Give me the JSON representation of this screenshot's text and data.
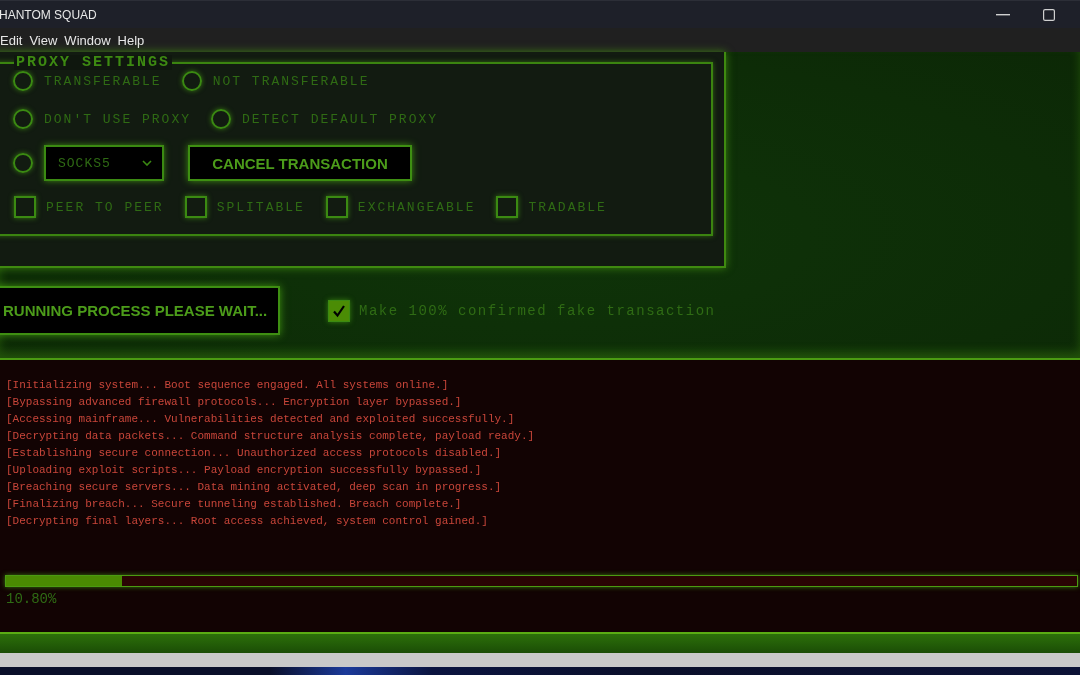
{
  "window": {
    "title": "HANTOM SQUAD"
  },
  "menu_bar": [
    "Edit",
    "View",
    "Window",
    "Help"
  ],
  "proxy_settings": {
    "legend": "PROXY SETTINGS",
    "rows": [
      {
        "items": [
          {
            "kind": "radio",
            "label": "TRANSFERABLE",
            "selected": false
          },
          {
            "kind": "radio",
            "label": "NOT TRANSFERABLE",
            "selected": false
          }
        ]
      },
      {
        "items": [
          {
            "kind": "radio",
            "label": "DON'T USE PROXY",
            "selected": false
          },
          {
            "kind": "radio",
            "label": "DETECT DEFAULT PROXY",
            "selected": false
          }
        ]
      },
      {
        "items": [
          {
            "kind": "radio",
            "selected": false
          },
          {
            "kind": "select",
            "value": "SOCKS5"
          },
          {
            "kind": "button",
            "label": "CANCEL TRANSACTION"
          }
        ]
      },
      {
        "items": [
          {
            "kind": "checkbox",
            "label": "PEER TO PEER",
            "checked": false
          },
          {
            "kind": "checkbox",
            "label": "SPLITABLE",
            "checked": false
          },
          {
            "kind": "checkbox",
            "label": "EXCHANGEABLE",
            "checked": false
          },
          {
            "kind": "checkbox",
            "label": "TRADABLE",
            "checked": false
          }
        ]
      }
    ]
  },
  "actions": {
    "run_button": "RUNNING PROCESS PLEASE WAIT...",
    "confirm_option": {
      "label": "Make 100% confirmed fake transaction",
      "checked": true
    }
  },
  "console": {
    "lines": [
      "[Initializing system... Boot sequence engaged. All systems online.]",
      "[Bypassing advanced firewall protocols... Encryption layer bypassed.]",
      "[Accessing mainframe... Vulnerabilities detected and exploited successfully.]",
      "[Decrypting data packets... Command structure analysis complete, payload ready.]",
      "[Establishing secure connection... Unauthorized access protocols disabled.]",
      "[Uploading exploit scripts... Payload encryption successfully bypassed.]",
      "[Breaching secure servers... Data mining activated, deep scan in progress.]",
      "[Finalizing breach... Secure tunneling established. Breach complete.]",
      "[Decrypting final layers... Root access achieved, system control gained.]"
    ]
  },
  "progress": {
    "level": 0.108,
    "label": "10.80%"
  }
}
